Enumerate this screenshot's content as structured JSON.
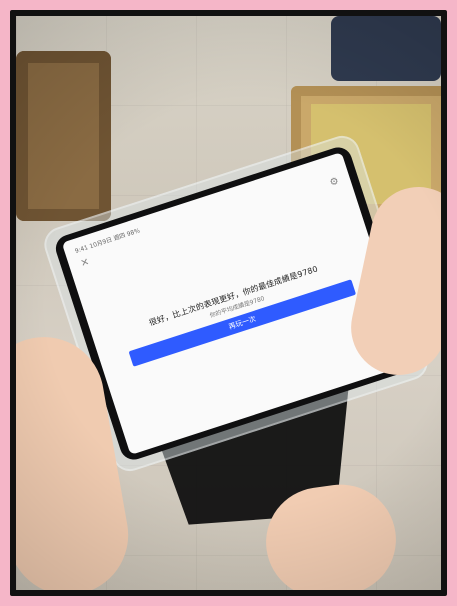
{
  "ui": {
    "status_left": "9:41 10月9日 週四 98%",
    "status_right": "",
    "message": "很好，比上次的表現更好，你的最佳成績是9780",
    "submessage": "你的平均成績是9780",
    "primary_button": "再玩一次",
    "close_icon": "close-icon",
    "settings_icon": "gear-icon"
  },
  "colors": {
    "background_border": "#f5b6c8",
    "primary_button": "#2f5bff"
  }
}
